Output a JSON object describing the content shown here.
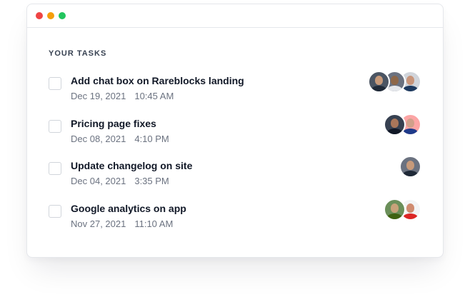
{
  "window": {
    "traffic_lights": [
      "#ef4444",
      "#f59e0b",
      "#22c55e"
    ]
  },
  "section": {
    "heading": "YOUR TASKS"
  },
  "tasks": [
    {
      "title": "Add chat box on Rareblocks landing",
      "date": "Dec 19, 2021",
      "time": "10:45 AM",
      "avatars": [
        {
          "name": "avatar-1",
          "bg": "#4b5563",
          "skin": "#c79a7a",
          "shirt": "#1f2937"
        },
        {
          "name": "avatar-2",
          "bg": "#6b7280",
          "skin": "#8d6748",
          "shirt": "#e5e7eb"
        },
        {
          "name": "avatar-3",
          "bg": "#d1d5db",
          "skin": "#c8957a",
          "shirt": "#1e3a5f"
        }
      ]
    },
    {
      "title": "Pricing page fixes",
      "date": "Dec 08, 2021",
      "time": "4:10 PM",
      "avatars": [
        {
          "name": "avatar-1",
          "bg": "#374151",
          "skin": "#a9765a",
          "shirt": "#111827"
        },
        {
          "name": "avatar-2",
          "bg": "#fca5a5",
          "skin": "#d0a08a",
          "shirt": "#1e3a8a"
        }
      ]
    },
    {
      "title": "Update changelog on site",
      "date": "Dec 04, 2021",
      "time": "3:35 PM",
      "avatars": [
        {
          "name": "avatar-1",
          "bg": "#6b7280",
          "skin": "#c79a7a",
          "shirt": "#1f2937"
        }
      ]
    },
    {
      "title": "Google analytics on app",
      "date": "Nov 27, 2021",
      "time": "11:10 AM",
      "avatars": [
        {
          "name": "avatar-1",
          "bg": "#6b8f5a",
          "skin": "#c8a27a",
          "shirt": "#3f6212"
        },
        {
          "name": "avatar-2",
          "bg": "#f3f4f6",
          "skin": "#d08b70",
          "shirt": "#dc2626"
        }
      ]
    }
  ]
}
